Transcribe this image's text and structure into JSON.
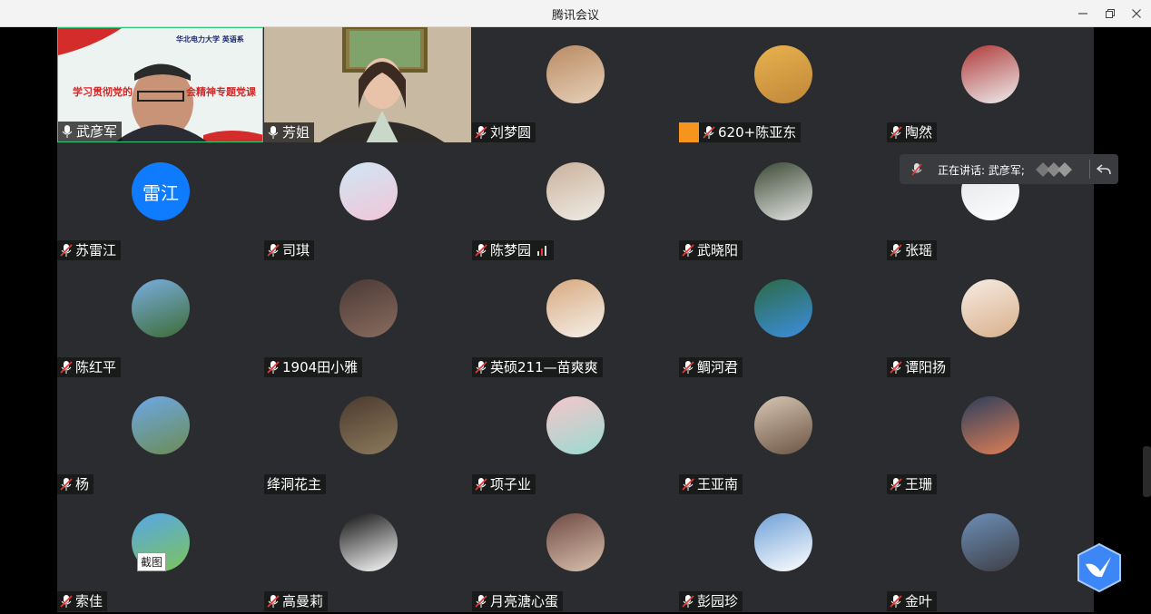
{
  "window": {
    "title": "腾讯会议"
  },
  "speaking": {
    "label": "正在讲话: 武彦军;"
  },
  "screenshot_tip": "截图",
  "video_banner": {
    "left": "学习贯彻党的",
    "right": "会精神专题党课",
    "logo": "华北电力大学 英语系"
  },
  "participants": [
    {
      "name": "武彦军"
    },
    {
      "name": "芳姐"
    },
    {
      "name": "刘梦圆"
    },
    {
      "name": "620+陈亚东"
    },
    {
      "name": "陶然"
    },
    {
      "name": "苏雷江",
      "avatar_text": "雷江"
    },
    {
      "name": "司琪"
    },
    {
      "name": "陈梦园"
    },
    {
      "name": "武晓阳"
    },
    {
      "name": "张瑶"
    },
    {
      "name": "陈红平"
    },
    {
      "name": "1904田小雅"
    },
    {
      "name": "英硕211—苗爽爽"
    },
    {
      "name": "鲷河君"
    },
    {
      "name": "谭阳扬"
    },
    {
      "name": "杨"
    },
    {
      "name": "绛洞花主"
    },
    {
      "name": "项子业"
    },
    {
      "name": "王亚南"
    },
    {
      "name": "王珊"
    },
    {
      "name": "索佳"
    },
    {
      "name": "高曼莉"
    },
    {
      "name": "月亮溏心蛋"
    },
    {
      "name": "彭园珍"
    },
    {
      "name": "金叶"
    }
  ],
  "colors": {
    "tile_bg": "#2b2c2f",
    "accent": "#0f7bff",
    "active_border": "#30c97a"
  }
}
